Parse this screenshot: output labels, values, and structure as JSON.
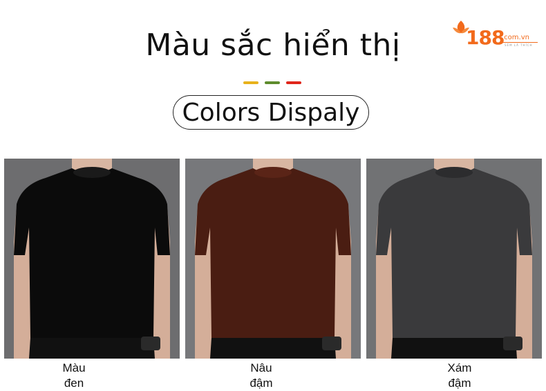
{
  "header": {
    "title": "Màu sắc hiển thị",
    "subtitle": "Colors Dispaly",
    "dash_colors": [
      "#e8b21c",
      "#5e8b2c",
      "#e0261b"
    ]
  },
  "logo": {
    "number": "188",
    "domain": ".com.vn",
    "tagline": "SẼM LÀ THÍCH",
    "color": "#f26a1b"
  },
  "products": [
    {
      "caption_line1": "Màu",
      "caption_line2": "đen",
      "shirt_color": "#0b0b0b",
      "background": "#6d6d6f",
      "icon": "black-tshirt"
    },
    {
      "caption_line1": "Nâu",
      "caption_line2": "đậm",
      "shirt_color": "#4a1d12",
      "background": "#77787b",
      "icon": "brown-tshirt"
    },
    {
      "caption_line1": "Xám",
      "caption_line2": "đậm",
      "shirt_color": "#3a3a3c",
      "background": "#717274",
      "icon": "gray-tshirt"
    }
  ]
}
